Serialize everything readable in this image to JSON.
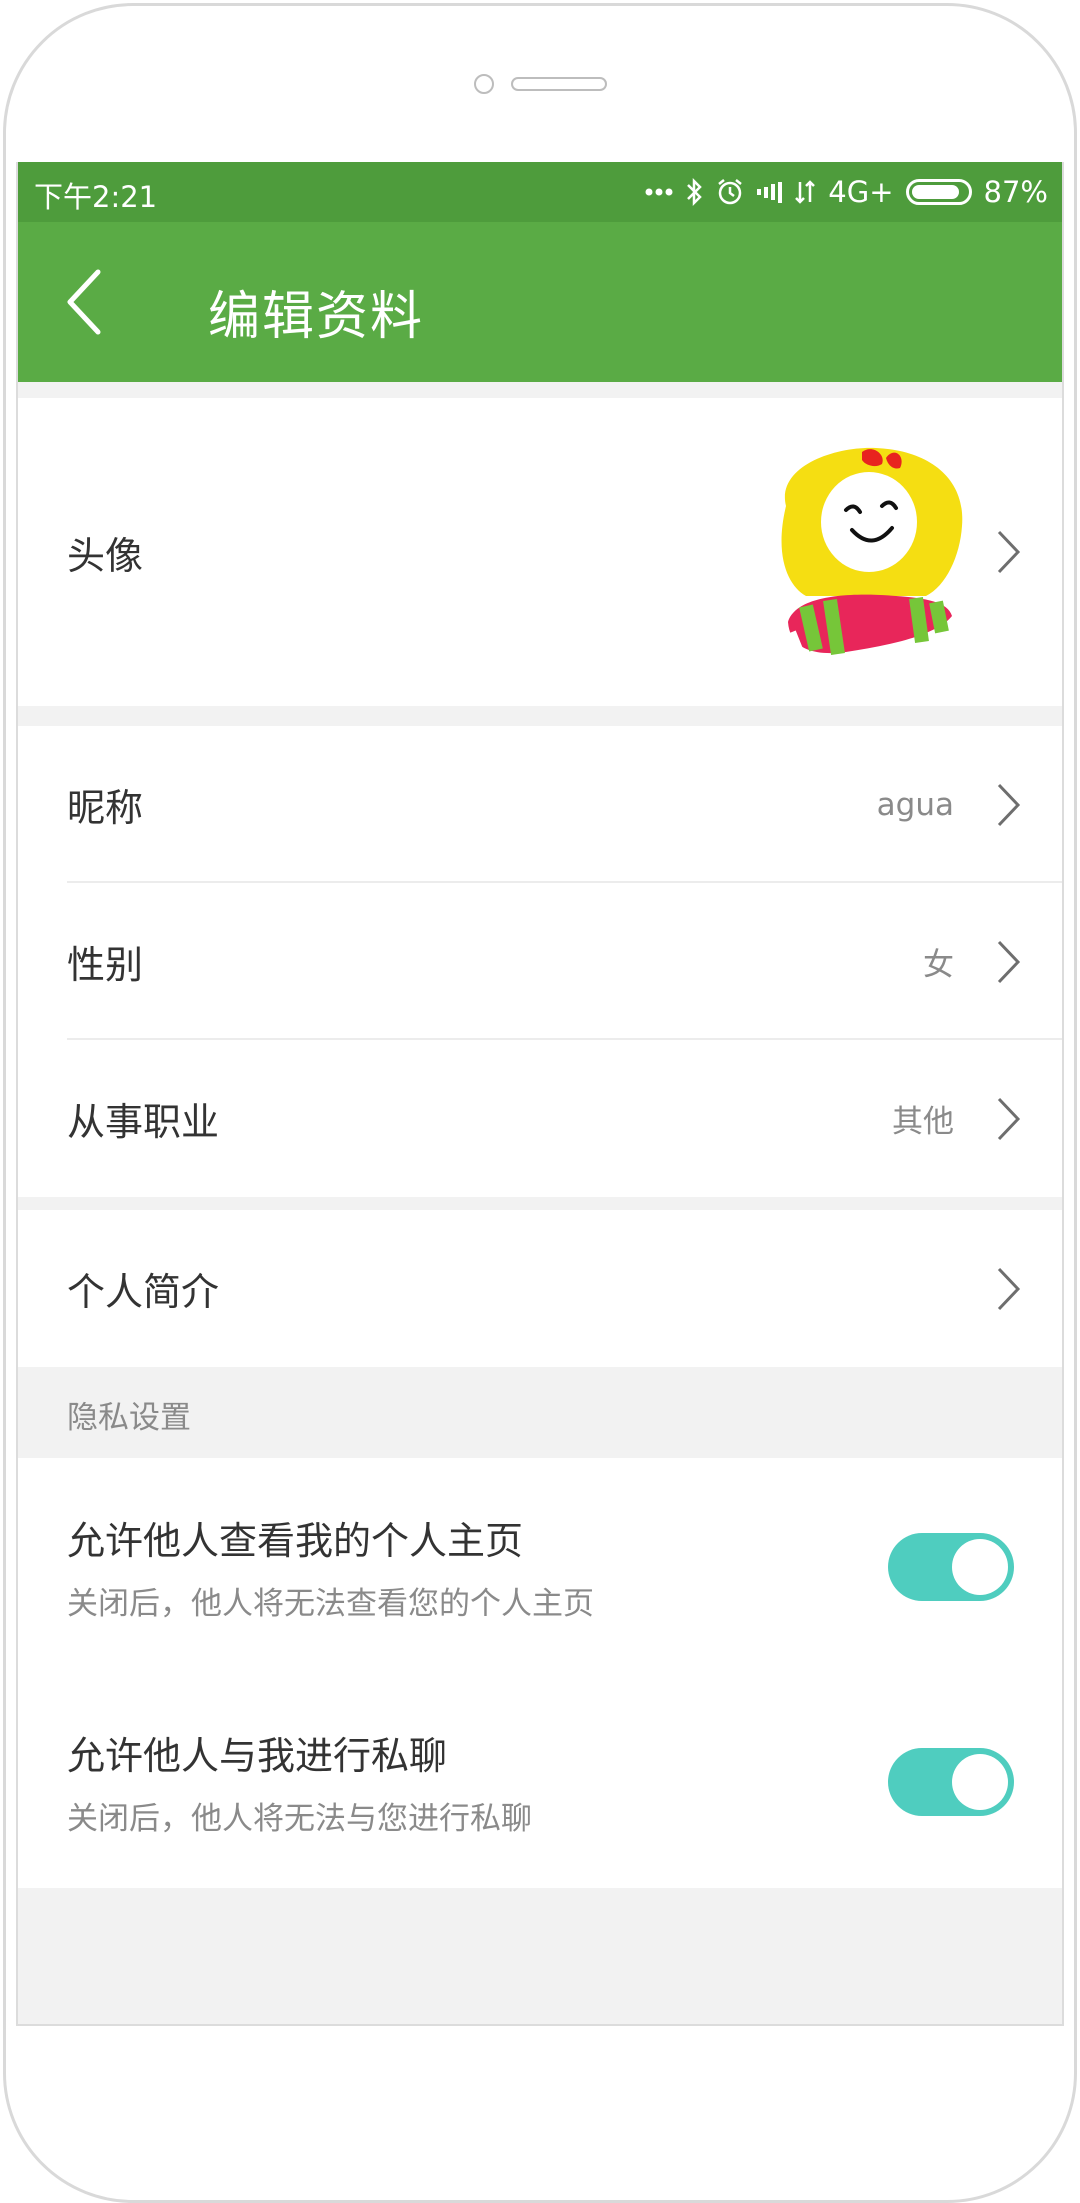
{
  "status_bar": {
    "time": "下午2:21",
    "network": "4G+",
    "battery_percent": "87%",
    "battery_level": 0.87,
    "icons": [
      "more-dots-icon",
      "bluetooth-icon",
      "alarm-icon",
      "signal-icon",
      "data-transfer-icon",
      "battery-icon"
    ]
  },
  "app_bar": {
    "title": "编辑资料",
    "back_icon": "chevron-left-icon",
    "color": "#5aab45"
  },
  "profile": {
    "avatar_label": "头像",
    "rows": [
      {
        "label": "昵称",
        "value": "agua"
      },
      {
        "label": "性别",
        "value": "女"
      },
      {
        "label": "从事职业",
        "value": "其他"
      }
    ],
    "bio_label": "个人简介"
  },
  "privacy": {
    "header": "隐私设置",
    "settings": [
      {
        "title": "允许他人查看我的个人主页",
        "subtitle": "关闭后，他人将无法查看您的个人主页",
        "enabled": true
      },
      {
        "title": "允许他人与我进行私聊",
        "subtitle": "关闭后，他人将无法与您进行私聊",
        "enabled": true
      }
    ],
    "toggle_color": "#4fcdbf"
  }
}
